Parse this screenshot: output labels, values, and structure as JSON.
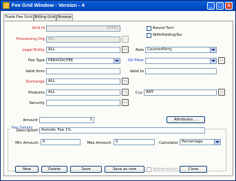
{
  "window": {
    "title": "Fee Grid Window - Version - 4"
  },
  "tabs": [
    "Trade Fee Grid",
    "Billing Grid",
    "Browse"
  ],
  "form": {
    "grid_id": {
      "label": "Grid Id",
      "value": "10461"
    },
    "processing_org": {
      "label": "Processing Org",
      "value": "ALL"
    },
    "legal_entity": {
      "label": "Legal Entity",
      "value": "ALL"
    },
    "role": {
      "label": "Role",
      "value": "CounterParty"
    },
    "fee_type": {
      "label": "Fee Type",
      "value": "PERIODICFEE"
    },
    "sd_filter": {
      "label": "SD Filter",
      "value": ""
    },
    "valid_from": {
      "label": "Valid from",
      "value": ""
    },
    "valid_to": {
      "label": "Valid to",
      "value": ""
    },
    "exchange": {
      "label": "Exchange",
      "value": "ALL"
    },
    "products": {
      "label": "Products",
      "value": "ALL"
    },
    "ccy": {
      "label": "Ccy",
      "value": "ANY"
    },
    "security": {
      "label": "Security",
      "value": ""
    },
    "round_turn": {
      "label": "Round Turn",
      "checked": false
    },
    "withholding_tax": {
      "label": "WithHoldingTax",
      "checked": false
    },
    "ellipsis": "..."
  },
  "fee_details": {
    "title": "Fee Details",
    "amount": {
      "label": "Amount",
      "value": "1"
    },
    "attributes_button": "Attributes ...",
    "description": {
      "label": "Description",
      "value": "Periodic Fee 1%"
    },
    "min_amount": {
      "label": "Min Amount.",
      "value": "0"
    },
    "max_amount": {
      "label": "Max Amount.",
      "value": "0"
    },
    "calculator": {
      "label": "Calculator",
      "value": "Percentage"
    }
  },
  "buttons": {
    "new": "New",
    "delete": "Delete",
    "save": "Save",
    "save_as_new": "Save as new",
    "authorization": "Authorization",
    "close": "Close"
  },
  "colors": {
    "title_bar": "#0a5fd8",
    "required_label": "#d01010",
    "link_label": "#1040d0",
    "group_title": "#2050b0"
  }
}
